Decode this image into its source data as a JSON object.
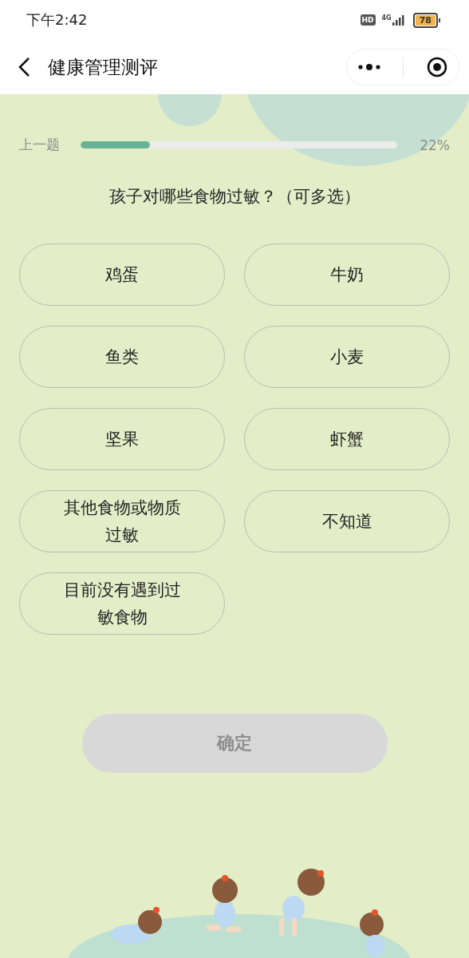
{
  "status_bar": {
    "time": "下午2:42",
    "hd_badge": "HD",
    "network": "4G",
    "battery": "78"
  },
  "header": {
    "title": "健康管理测评"
  },
  "progress": {
    "back_label": "上一题",
    "level": 0.22,
    "percent": "22%"
  },
  "question": "孩子对哪些食物过敏？（可多选）",
  "options": [
    {
      "label": "鸡蛋",
      "selected": false
    },
    {
      "label": "牛奶",
      "selected": false
    },
    {
      "label": "鱼类",
      "selected": false
    },
    {
      "label": "小麦",
      "selected": false
    },
    {
      "label": "坚果",
      "selected": false
    },
    {
      "label": "虾蟹",
      "selected": false
    },
    {
      "label": "其他食物或物质过敏",
      "selected": false
    },
    {
      "label": "不知道",
      "selected": false
    },
    {
      "label": "目前没有遇到过敏食物",
      "selected": false
    }
  ],
  "confirm": {
    "label": "确定",
    "disabled": true
  }
}
